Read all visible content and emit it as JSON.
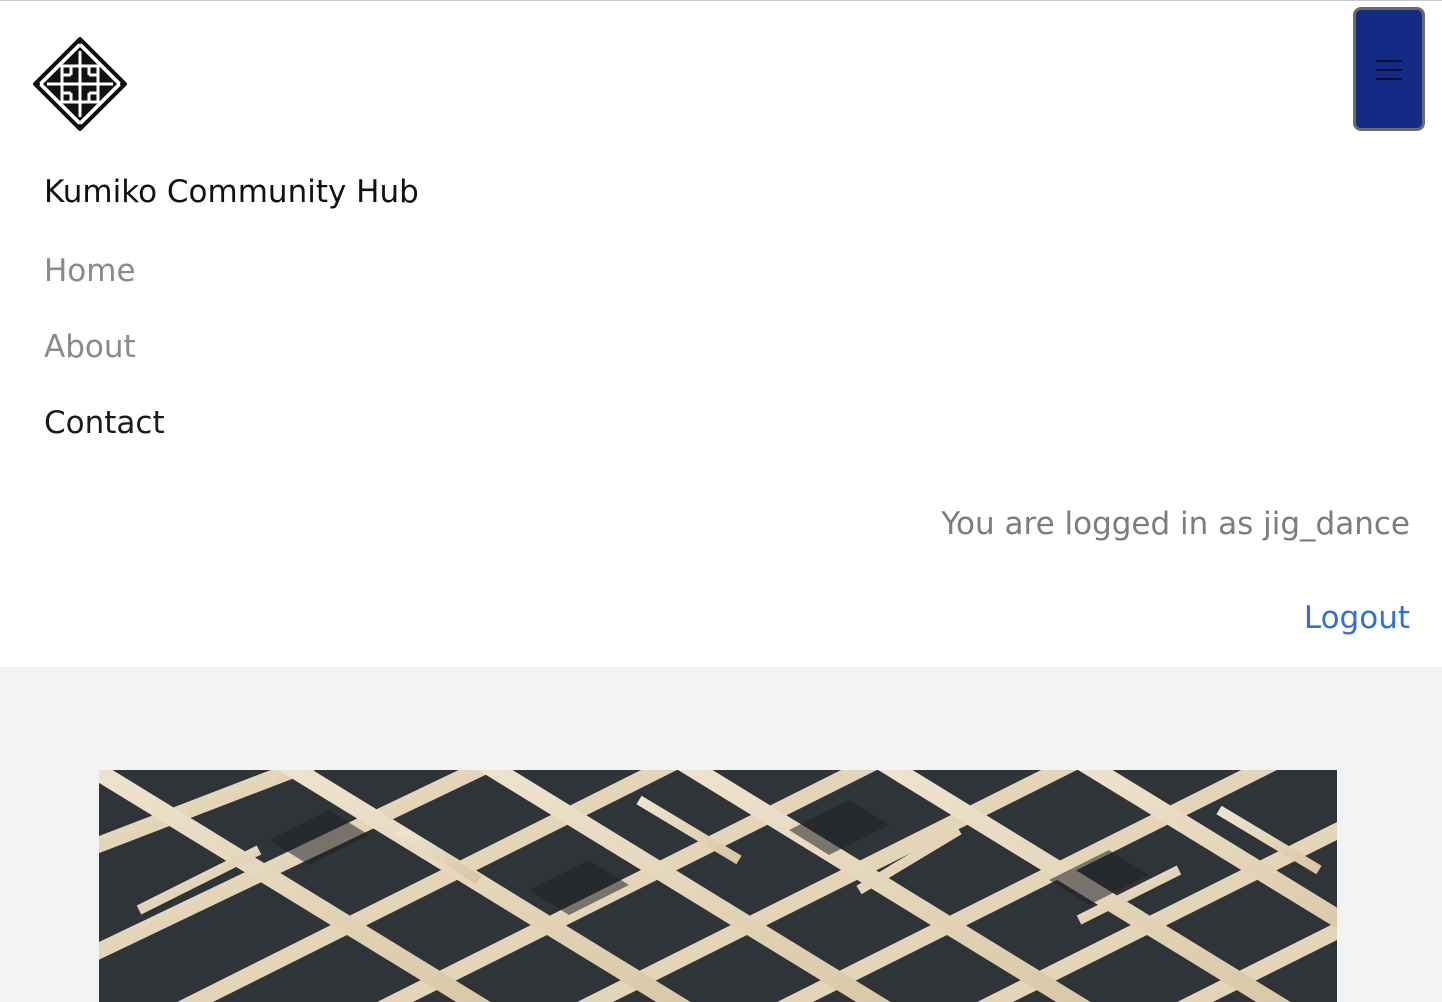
{
  "header": {
    "site_title": "Kumiko Community Hub",
    "logo_icon": "kumiko-lattice-logo-icon",
    "menu_icon": "hamburger-menu-icon"
  },
  "nav": {
    "items": [
      {
        "label": "Home",
        "active": false
      },
      {
        "label": "About",
        "active": false
      },
      {
        "label": "Contact",
        "active": true
      }
    ]
  },
  "user": {
    "status_text": "You are logged in as jig_dance",
    "logout_label": "Logout"
  },
  "colors": {
    "menu_button_bg": "#132b85",
    "link": "#2f6fdb",
    "nav_inactive": "#8a8a8a",
    "content_bg": "#f3f3f3"
  },
  "hero": {
    "image": "kumiko-wooden-lattice-photo"
  }
}
